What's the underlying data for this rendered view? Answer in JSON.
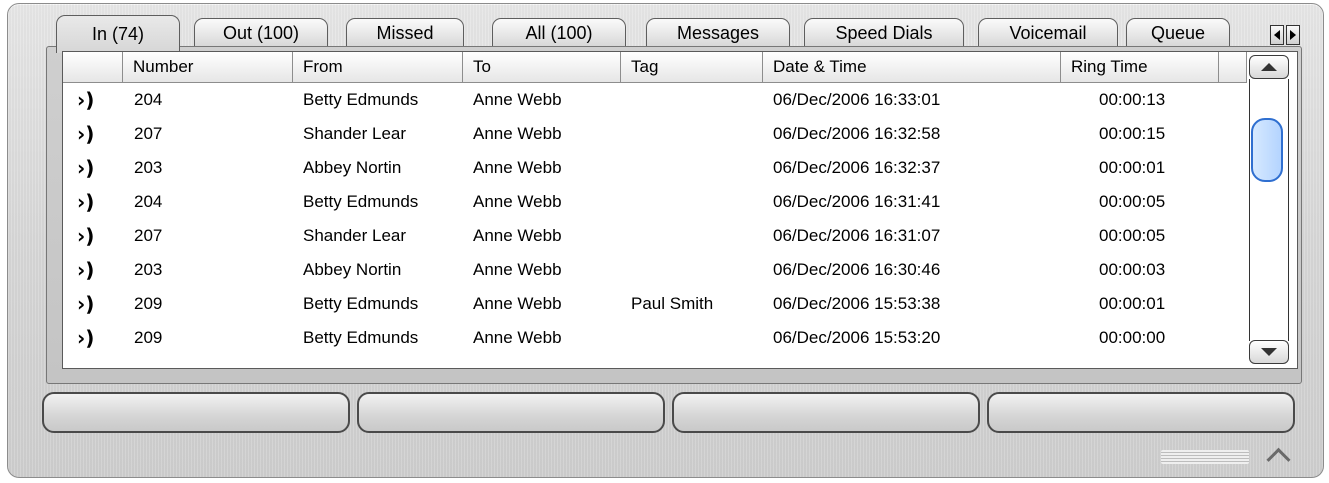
{
  "tabs": [
    {
      "label": "In (74)"
    },
    {
      "label": "Out (100)"
    },
    {
      "label": "Missed"
    },
    {
      "label": "All (100)"
    },
    {
      "label": "Messages"
    },
    {
      "label": "Speed Dials"
    },
    {
      "label": "Voicemail"
    },
    {
      "label": "Queue"
    }
  ],
  "table": {
    "columns": [
      "Number",
      "From",
      "To",
      "Tag",
      "Date & Time",
      "Ring Time"
    ],
    "rows": [
      {
        "icon": "incoming-call-icon",
        "number": "204",
        "from": "Betty Edmunds",
        "to": "Anne Webb",
        "tag": "",
        "datetime": "06/Dec/2006 16:33:01",
        "ring": "00:00:13"
      },
      {
        "icon": "incoming-call-icon",
        "number": "207",
        "from": "Shander Lear",
        "to": "Anne Webb",
        "tag": "",
        "datetime": "06/Dec/2006 16:32:58",
        "ring": "00:00:15"
      },
      {
        "icon": "incoming-call-icon",
        "number": "203",
        "from": "Abbey Nortin",
        "to": "Anne Webb",
        "tag": "",
        "datetime": "06/Dec/2006 16:32:37",
        "ring": "00:00:01"
      },
      {
        "icon": "incoming-call-icon",
        "number": "204",
        "from": "Betty Edmunds",
        "to": "Anne Webb",
        "tag": "",
        "datetime": "06/Dec/2006 16:31:41",
        "ring": "00:00:05"
      },
      {
        "icon": "incoming-call-icon",
        "number": "207",
        "from": "Shander Lear",
        "to": "Anne Webb",
        "tag": "",
        "datetime": "06/Dec/2006 16:31:07",
        "ring": "00:00:05"
      },
      {
        "icon": "incoming-call-icon",
        "number": "203",
        "from": "Abbey Nortin",
        "to": "Anne Webb",
        "tag": "",
        "datetime": "06/Dec/2006 16:30:46",
        "ring": "00:00:03"
      },
      {
        "icon": "incoming-call-icon",
        "number": "209",
        "from": "Betty Edmunds",
        "to": "Anne Webb",
        "tag": "Paul Smith",
        "datetime": "06/Dec/2006 15:53:38",
        "ring": "00:00:01"
      },
      {
        "icon": "incoming-call-icon",
        "number": "209",
        "from": "Betty Edmunds",
        "to": "Anne Webb",
        "tag": "",
        "datetime": "06/Dec/2006 15:53:20",
        "ring": "00:00:00"
      }
    ]
  },
  "icons": {
    "tab_prev": "left-arrow-icon",
    "tab_next": "right-arrow-icon",
    "scroll_up": "scroll-up-arrow-icon",
    "scroll_down": "scroll-down-arrow-icon",
    "collapse": "chevron-up-icon",
    "call_glyph": "›)"
  },
  "colors": {
    "scroll_thumb": "#b4d4ff",
    "scroll_thumb_border": "#2f6fd0"
  }
}
